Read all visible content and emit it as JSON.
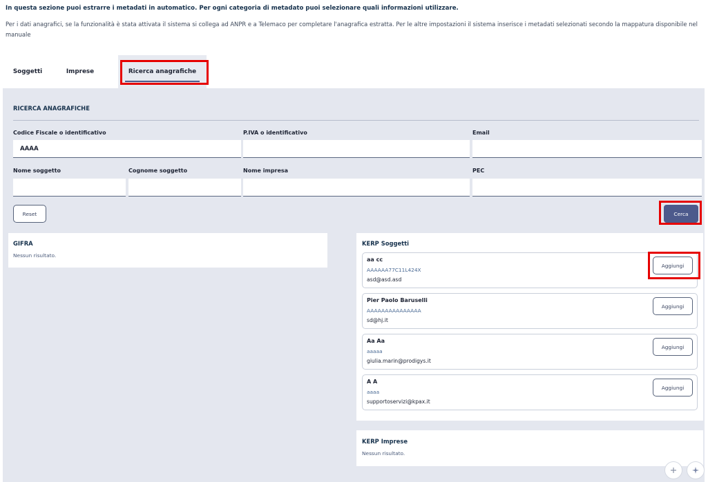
{
  "intro": {
    "bold": "In questa sezione puoi estrarre i metadati in automatico. Per ogni categoria di metadato puoi selezionare quali informazioni utilizzare.",
    "text": "Per i dati anagrafici, se la funzionalità è stata attivata il sistema si collega ad ANPR e a Telemaco per completare l'anagrafica estratta. Per le altre impostazioni il sistema inserisce i metadati selezionati secondo la mappatura disponibile nel manuale"
  },
  "tabs": [
    {
      "label": "Soggetti"
    },
    {
      "label": "Imprese"
    },
    {
      "label": "Ricerca anagrafiche",
      "active": true
    }
  ],
  "search": {
    "title": "RICERCA ANAGRAFICHE",
    "fields": {
      "codice_fiscale": {
        "label": "Codice Fiscale o identificativo",
        "value": "AAAA"
      },
      "piva": {
        "label": "P.IVA o identificativo",
        "value": ""
      },
      "email": {
        "label": "Email",
        "value": ""
      },
      "nome_soggetto": {
        "label": "Nome soggetto",
        "value": ""
      },
      "cognome_soggetto": {
        "label": "Cognome soggetto",
        "value": ""
      },
      "nome_impresa": {
        "label": "Nome impresa",
        "value": ""
      },
      "pec": {
        "label": "PEC",
        "value": ""
      }
    },
    "reset_label": "Reset",
    "cerca_label": "Cerca"
  },
  "gifra": {
    "title": "GIFRA",
    "empty": "Nessun risultato."
  },
  "kerp_soggetti": {
    "title": "KERP Soggetti",
    "add_label": "Aggiungi",
    "items": [
      {
        "name": "aa cc",
        "id": "AAAAAA77C11L424X",
        "email": "asd@asd.asd"
      },
      {
        "name": "Pier Paolo Baruselli",
        "id": "AAAAAAAAAAAAAAA",
        "email": "sd@hj.it"
      },
      {
        "name": "Aa Aa",
        "id": "aaaaa",
        "email": "giulia.marin@prodigys.it"
      },
      {
        "name": "A A",
        "id": "aaaa",
        "email": "supportoservizi@kpax.it"
      }
    ]
  },
  "kerp_imprese": {
    "title": "KERP Imprese",
    "empty": "Nessun risultato."
  },
  "fabs": {
    "plus_icon": "plus-icon",
    "sparkle_icon": "sparkle-icon"
  },
  "colors": {
    "highlight": "#e60000",
    "primary": "#4d5a8c",
    "panel_bg": "#e4e7ef"
  }
}
